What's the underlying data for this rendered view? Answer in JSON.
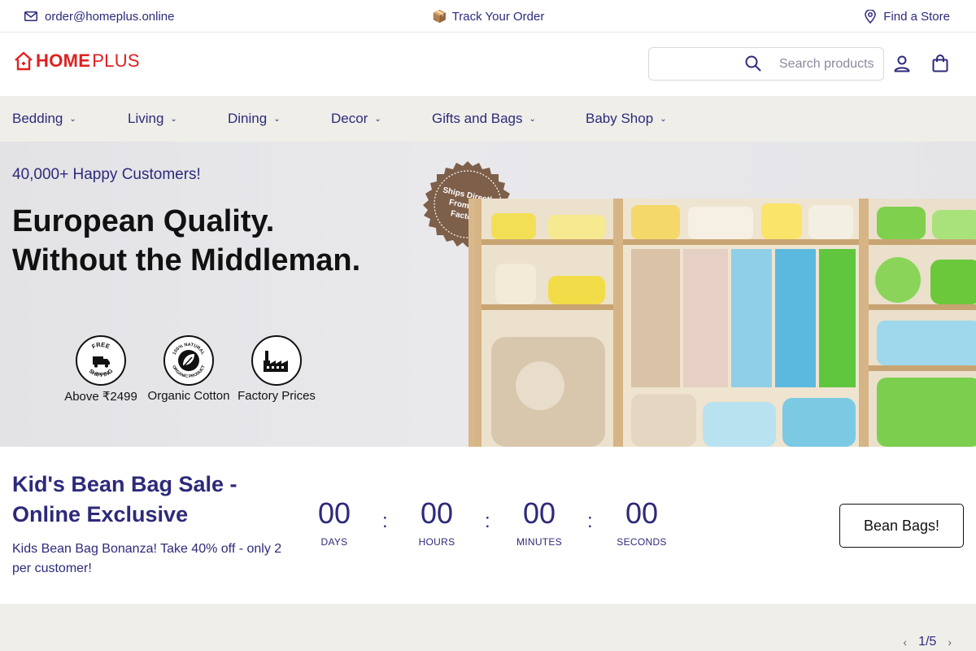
{
  "topbar": {
    "email": "order@homeplus.online",
    "track_icon": "📦",
    "track": "Track Your Order",
    "store": "Find a Store"
  },
  "header": {
    "logo_home": "HOME",
    "logo_plus": "PLUS",
    "search_placeholder": "Search products"
  },
  "nav": {
    "items": [
      {
        "label": "Bedding"
      },
      {
        "label": "Living"
      },
      {
        "label": "Dining"
      },
      {
        "label": "Decor"
      },
      {
        "label": "Gifts and Bags"
      },
      {
        "label": "Baby Shop"
      }
    ]
  },
  "hero": {
    "eyebrow": "40,000+ Happy Customers!",
    "headline_line1": "European Quality.",
    "headline_line2": "Without the Middleman.",
    "stamp_line1": "Ships Directly",
    "stamp_line2": "From Our",
    "stamp_line3": "Factory",
    "badges": [
      {
        "ring_text_top": "FREE",
        "ring_text_bottom": "SHIPPING",
        "label": "Above ₹2499"
      },
      {
        "ring_text_top": "100% NATURAL",
        "ring_text_bottom": "ORGANIC PRODUCT",
        "label": "Organic Cotton"
      },
      {
        "label": "Factory Prices"
      }
    ]
  },
  "sale": {
    "title": "Kid's Bean Bag Sale - Online Exclusive",
    "description": "Kids Bean Bag Bonanza! Take 40% off - only 2 per customer!",
    "timer": [
      {
        "value": "00",
        "label": "DAYS"
      },
      {
        "value": "00",
        "label": "HOURS"
      },
      {
        "value": "00",
        "label": "MINUTES"
      },
      {
        "value": "00",
        "label": "SECONDS"
      }
    ],
    "colon": ":",
    "cta": "Bean Bags!"
  },
  "pager": {
    "text": "1/5",
    "prev": "‹",
    "next": "›"
  },
  "colors": {
    "brand_red": "#e02020",
    "text_navy": "#2d2a7a",
    "nav_bg": "#efeee9"
  }
}
